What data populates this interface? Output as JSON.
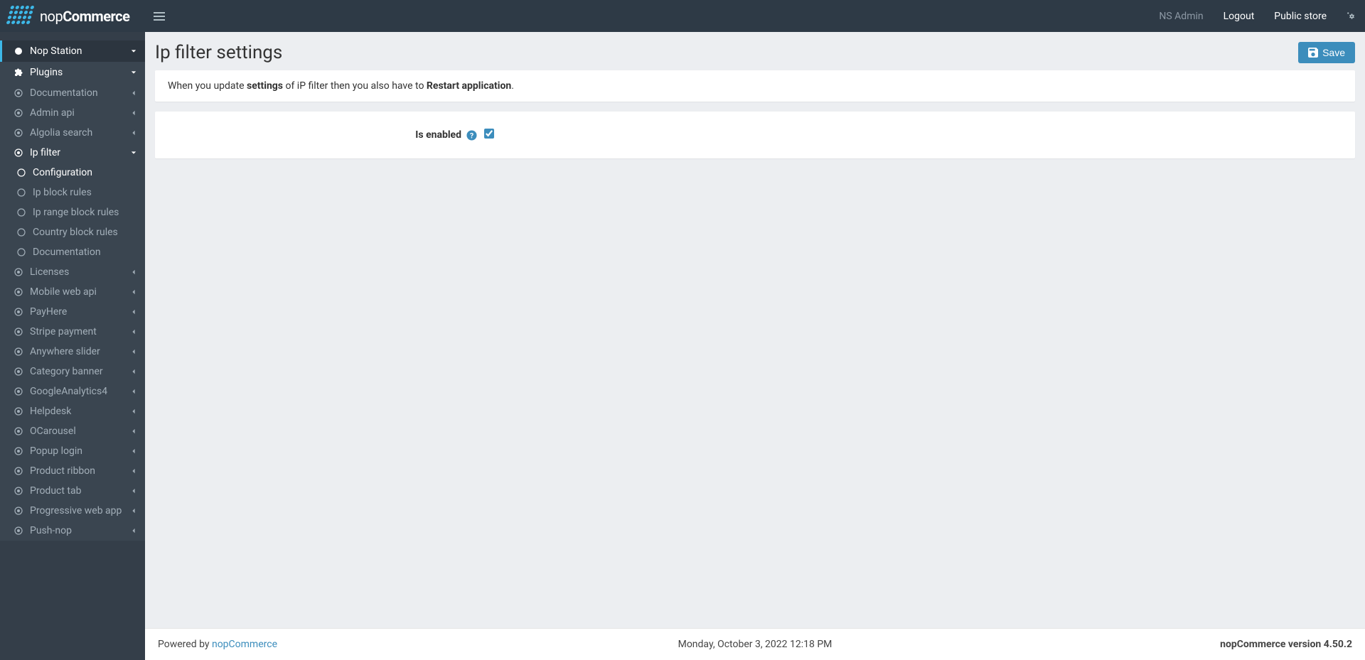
{
  "brand": {
    "name_light": "nop",
    "name_bold": "Commerce"
  },
  "topbar": {
    "user_label": "NS Admin",
    "logout": "Logout",
    "public_store": "Public store"
  },
  "sidebar": {
    "nop_station": "Nop Station",
    "plugins": "Plugins",
    "items": [
      {
        "label": "Documentation",
        "chevron": true
      },
      {
        "label": "Admin api",
        "chevron": true
      },
      {
        "label": "Algolia search",
        "chevron": true
      }
    ],
    "ip_filter": "Ip filter",
    "ip_filter_children": [
      {
        "label": "Configuration",
        "current": true
      },
      {
        "label": "Ip block rules"
      },
      {
        "label": "Ip range block rules"
      },
      {
        "label": "Country block rules"
      },
      {
        "label": "Documentation"
      }
    ],
    "items2": [
      {
        "label": "Licenses",
        "chevron": true
      },
      {
        "label": "Mobile web api",
        "chevron": true
      },
      {
        "label": "PayHere",
        "chevron": true
      },
      {
        "label": "Stripe payment",
        "chevron": true
      },
      {
        "label": "Anywhere slider",
        "chevron": true
      },
      {
        "label": "Category banner",
        "chevron": true
      },
      {
        "label": "GoogleAnalytics4",
        "chevron": true
      },
      {
        "label": "Helpdesk",
        "chevron": true
      },
      {
        "label": "OCarousel",
        "chevron": true
      },
      {
        "label": "Popup login",
        "chevron": true
      },
      {
        "label": "Product ribbon",
        "chevron": true
      },
      {
        "label": "Product tab",
        "chevron": true
      },
      {
        "label": "Progressive web app",
        "chevron": true
      },
      {
        "label": "Push-nop",
        "chevron": true
      }
    ]
  },
  "page": {
    "title": "Ip filter settings",
    "save_label": "Save",
    "notice_pre": "When you update ",
    "notice_strong1": "settings",
    "notice_mid": " of iP filter then you also have to ",
    "notice_strong2": "Restart application",
    "notice_end": ".",
    "is_enabled_label": "Is enabled",
    "is_enabled_checked": true
  },
  "footer": {
    "powered_by": "Powered by ",
    "link": "nopCommerce",
    "datetime": "Monday, October 3, 2022 12:18 PM",
    "version": "nopCommerce version 4.50.2"
  }
}
